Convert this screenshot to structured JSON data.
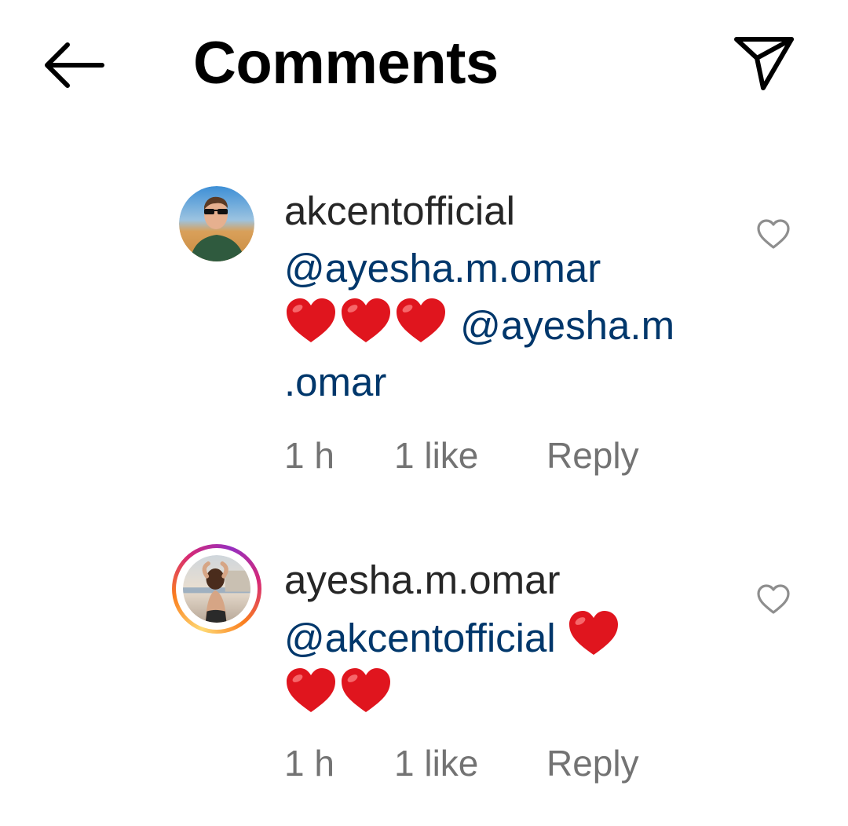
{
  "header": {
    "title": "Comments",
    "back_icon": "arrow-left-icon",
    "share_icon": "paper-plane-icon"
  },
  "comments": [
    {
      "username": "akcentofficial",
      "mention_1": "@ayesha.m.omar",
      "emoji_count": 3,
      "mention_2_a": "@ayesha.m",
      "mention_2_b": ".omar",
      "time": "1 h",
      "likes": "1 like",
      "reply": "Reply",
      "story_ring": false
    },
    {
      "username": "ayesha.m.omar",
      "mention_1": "@akcentofficial",
      "emoji_count": 3,
      "time": "1 h",
      "likes": "1 like",
      "reply": "Reply",
      "story_ring": true
    }
  ],
  "colors": {
    "text_primary": "#262626",
    "mention": "#00376b",
    "meta": "#737373",
    "heart_emoji": "#e0151e"
  }
}
